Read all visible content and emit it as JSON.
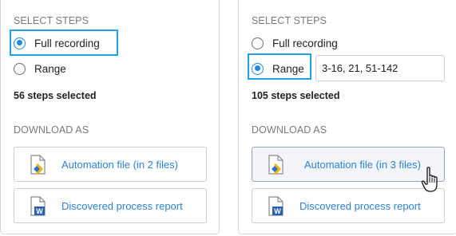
{
  "left": {
    "section_select": "SELECT STEPS",
    "options": [
      {
        "label": "Full recording",
        "checked": true
      },
      {
        "label": "Range",
        "checked": false
      }
    ],
    "count": "56 steps selected",
    "section_download": "DOWNLOAD AS",
    "downloads": [
      {
        "label": "Automation file (in 2 files)",
        "icon": "automation-file-icon"
      },
      {
        "label": "Discovered process report",
        "icon": "word-document-icon"
      }
    ]
  },
  "right": {
    "section_select": "SELECT STEPS",
    "options": [
      {
        "label": "Full recording",
        "checked": false
      },
      {
        "label": "Range",
        "checked": true
      }
    ],
    "range_value": "3-16, 21, 51-142",
    "count": "105 steps selected",
    "section_download": "DOWNLOAD AS",
    "downloads": [
      {
        "label": "Automation file (in 3 files)",
        "icon": "automation-file-icon"
      },
      {
        "label": "Discovered process report",
        "icon": "word-document-icon"
      }
    ]
  },
  "colors": {
    "accent": "#1e88e5",
    "highlight": "#1ca4e8",
    "link": "#2e82d6",
    "word_blue": "#2b5fb4",
    "automation_yellow": "#f6b400"
  },
  "word_letter": "W"
}
